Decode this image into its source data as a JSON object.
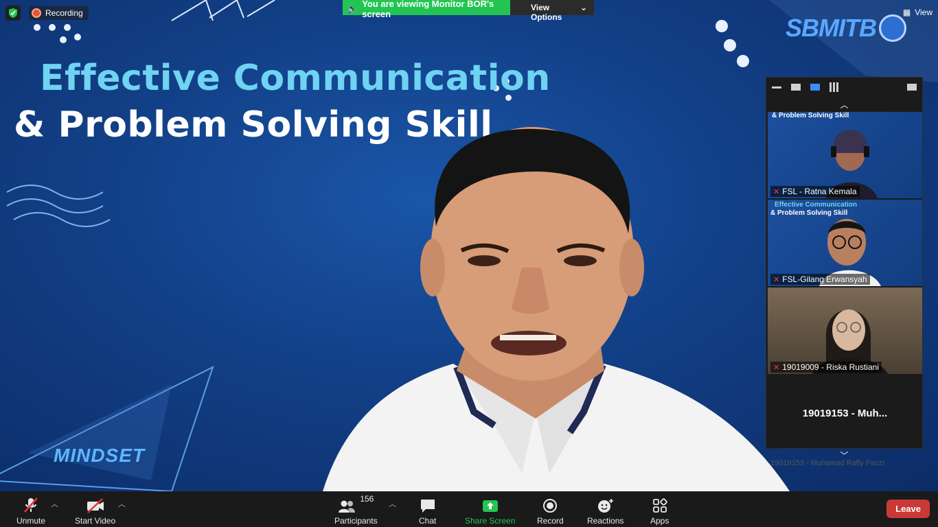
{
  "top": {
    "recording_label": "Recording",
    "banner_message": "You are viewing Monitor BOR's screen",
    "view_options_label": "View Options",
    "view_label": "View"
  },
  "slide": {
    "title_line1": "Effective Communication",
    "title_line2": "& Problem Solving Skill",
    "logo_text": "SBMITB",
    "bottom_logo_text": "MINDSET"
  },
  "gallery": {
    "tiles": [
      {
        "name": "FSL - Ratna Kemala"
      },
      {
        "name": "FSL-Gilang Erwansyah"
      },
      {
        "name": "19019009 - Riska Rustiani"
      }
    ],
    "blank_tile_name": "19019153 - Muh...",
    "ghost_row_name": "19019153 - Muhamad Rafly Fauzi",
    "mini_slide_line1": "Effective Communication",
    "mini_slide_line2": "& Problem Solving Skill"
  },
  "toolbar": {
    "unmute": "Unmute",
    "start_video": "Start Video",
    "participants": "Participants",
    "participants_count": "156",
    "chat": "Chat",
    "share_screen": "Share Screen",
    "record": "Record",
    "reactions": "Reactions",
    "apps": "Apps",
    "leave": "Leave"
  },
  "colors": {
    "accent_green": "#23c552",
    "leave_red": "#c93a36",
    "title_cyan": "#6fd3f2",
    "background_blue": "#123f86"
  }
}
